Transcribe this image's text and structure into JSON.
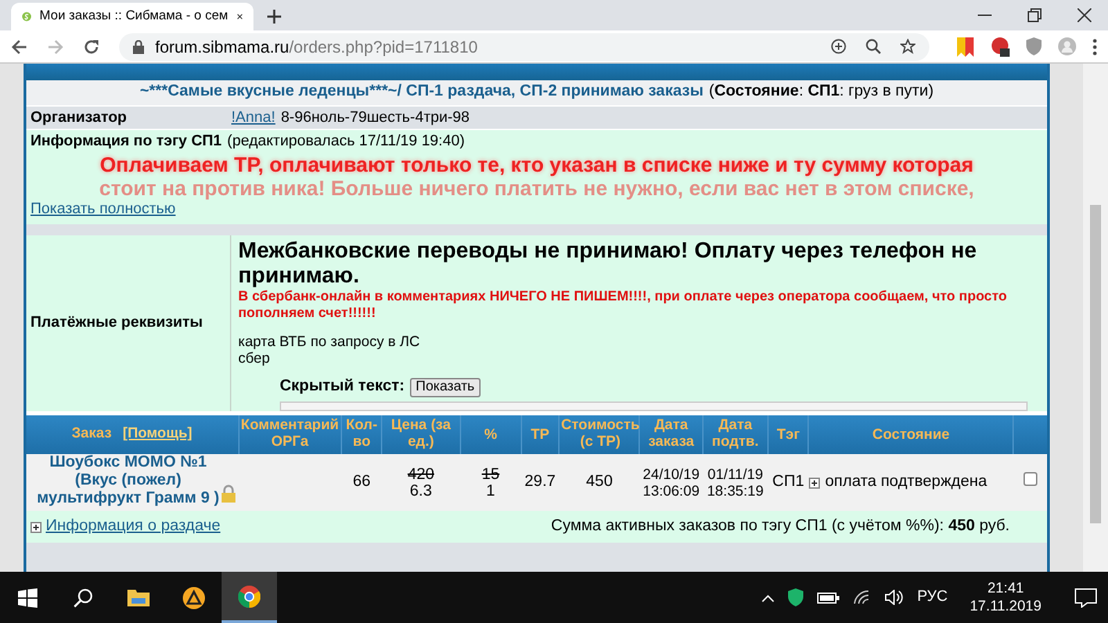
{
  "browser": {
    "tab_title": "Мои заказы :: Сибмама - о сем",
    "url_host": "forum.sibmama.ru",
    "url_path": "/orders.php?pid=1711810"
  },
  "title": {
    "heading": "~***Самые вкусные леденцы***~/ СП-1 раздача, СП-2 принимаю заказы",
    "status": "(**Состояние**: **СП1**: груз в пути)"
  },
  "organizer": {
    "label": "Организатор",
    "link": "!Anna!",
    "phone": "8-96ноль-79шесть-4три-98"
  },
  "tag_info": {
    "label": "Информация по тэгу СП1",
    "edited": "(редактировалась 17/11/19 19:40)",
    "notice": [
      "Оплачиваем ТР, оплачивают только те, кто указан в списке ниже и ту сумму которая",
      "стоит на против ника! Больше ничего платить не нужно, если вас нет в этом списке,"
    ],
    "show_more": "Показать полностью"
  },
  "payment": {
    "label": "Платёжные реквизиты",
    "heading": "Межбанковские переводы не принимаю! Оплату через телефон не принимаю.",
    "warning": "В сбербанк-онлайн в комментариях НИЧЕГО НЕ ПИШЕМ!!!!, при оплате через оператора сообщаем, что просто пополняем счет!!!!!!",
    "lines": [
      "карта ВТБ по запросу в ЛС",
      "сбер"
    ],
    "hidden_label": "Скрытый текст:",
    "hidden_button": "Показать"
  },
  "orders": {
    "columns": [
      {
        "label": "Заказ",
        "link": "[Помощь]"
      },
      {
        "label": "Комментарий ОРГа"
      },
      {
        "label": "Кол-во"
      },
      {
        "label": "Цена (за ед.)"
      },
      {
        "label": "%"
      },
      {
        "label": "ТР"
      },
      {
        "label": "Стоимость (с ТР)"
      },
      {
        "label": "Дата заказа"
      },
      {
        "label": "Дата подтв."
      },
      {
        "label": "Тэг"
      },
      {
        "label": "Состояние"
      }
    ],
    "rows": [
      {
        "item": "Шоубокс МОМО №1 (Вкус (пожел) мультифрукт Грамм 9 )",
        "qty": "66",
        "price_old": "420",
        "price": "6.3",
        "percent_old": "15",
        "percent": "1",
        "tr": "29.7",
        "cost": "450",
        "order_date": "24/10/19",
        "order_time": "13:06:09",
        "confirm_date": "01/11/19",
        "confirm_time": "18:35:19",
        "tag": "СП1",
        "status": "оплата подтверждена",
        "checked": false
      }
    ],
    "info_link": "Информация о раздаче",
    "total": "Сумма активных заказов по тэгу СП1 (с учётом %%): **450** руб."
  },
  "taskbar": {
    "language": "РУС",
    "time": "21:41",
    "date": "17.11.2019"
  }
}
